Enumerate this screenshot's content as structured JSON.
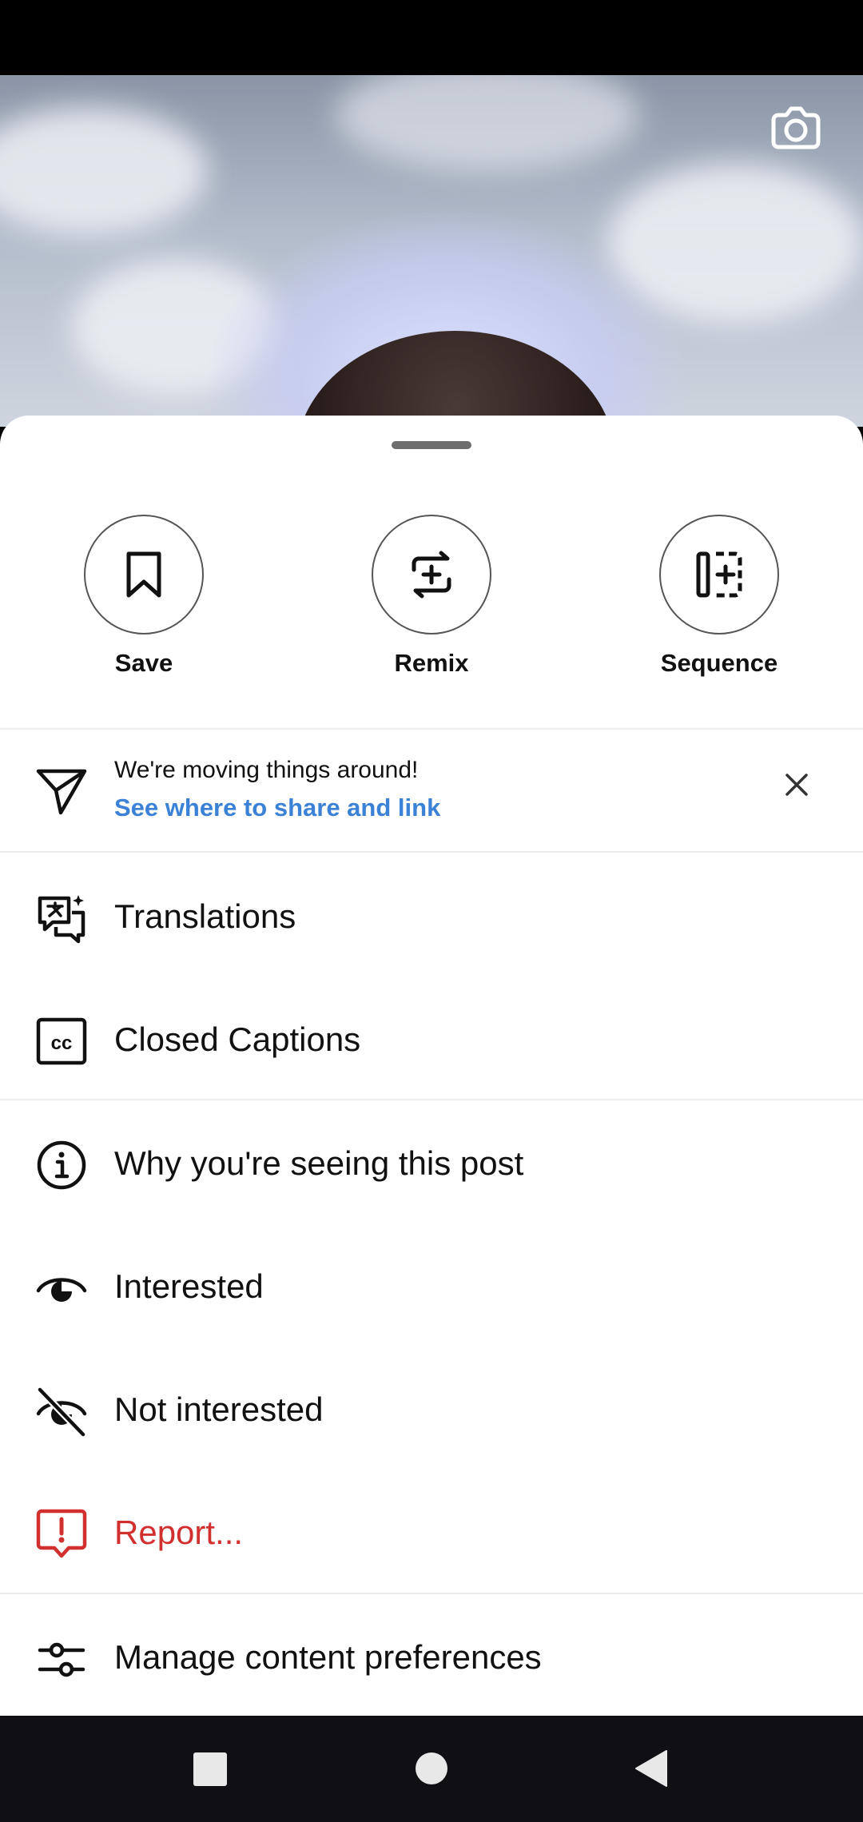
{
  "colors": {
    "sheet_bg": "#ffffff",
    "text_primary": "#111111",
    "link_blue": "#3b82d6",
    "report_red": "#d1302f",
    "navbar_bg": "#0f0f14"
  },
  "background": {
    "camera_icon": "camera-icon"
  },
  "actions": [
    {
      "label": "Save",
      "icon": "bookmark-icon"
    },
    {
      "label": "Remix",
      "icon": "remix-icon"
    },
    {
      "label": "Sequence",
      "icon": "sequence-icon"
    }
  ],
  "notice": {
    "icon": "send-icon",
    "message": "We're moving things around!",
    "link": "See where to share and link",
    "close_icon": "close-icon"
  },
  "menu": {
    "translations": "Translations",
    "closed_captions": "Closed Captions",
    "why_seeing": "Why you're seeing this post",
    "interested": "Interested",
    "not_interested": "Not interested",
    "report": "Report...",
    "manage_prefs": "Manage content preferences"
  },
  "navigation": [
    "recents-button",
    "home-button",
    "back-button"
  ]
}
